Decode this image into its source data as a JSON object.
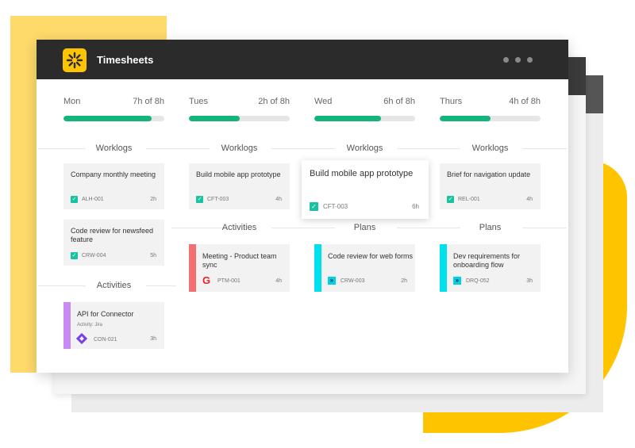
{
  "app": {
    "title": "Timesheets"
  },
  "colors": {
    "progress": "#14B57A",
    "check": "#17C3A0",
    "accent_red": "#F47070",
    "accent_cyan": "#00E1EE",
    "accent_purple": "#C98AF4",
    "logo": "#FFC400"
  },
  "days": [
    {
      "name": "Mon",
      "hours": "7h of 8h",
      "progress": 0.875
    },
    {
      "name": "Tues",
      "hours": "2h of 8h",
      "progress": 0.5
    },
    {
      "name": "Wed",
      "hours": "6h of 8h",
      "progress": 0.66
    },
    {
      "name": "Thurs",
      "hours": "4h of 8h",
      "progress": 0.5
    }
  ],
  "sections": {
    "worklogs": "Worklogs",
    "activities": "Activities",
    "plans": "Plans"
  },
  "cards": {
    "mon_1": {
      "title": "Company monthly meeting",
      "code": "ALH-001",
      "hours": "2h"
    },
    "mon_2": {
      "title": "Code review for newsfeed feature",
      "code": "CRW-004",
      "hours": "5h"
    },
    "mon_3": {
      "title": "API for Connector",
      "subtitle": "Activity: Jira",
      "code": "CON-021",
      "hours": "3h",
      "icon": "jira-icon"
    },
    "tue_1": {
      "title": "Build mobile app prototype",
      "code": "CFT-003",
      "hours": "4h"
    },
    "tue_2": {
      "title": "Meeting - Product team sync",
      "code": "PTM-001",
      "hours": "4h",
      "icon": "google-icon"
    },
    "wed_float": {
      "title": "Build mobile app prototype",
      "code": "CFT-003",
      "hours": "6h"
    },
    "wed_2": {
      "title": "Code review for web forms",
      "code": "CRW-003",
      "hours": "2h",
      "icon": "double-chevron-icon"
    },
    "thu_1": {
      "title": "Brief for navigation update",
      "code": "REL-001",
      "hours": "4h"
    },
    "thu_2": {
      "title": "Dev requirements for onboarding flow",
      "code": "DRQ-052",
      "hours": "3h",
      "icon": "double-chevron-icon"
    }
  }
}
